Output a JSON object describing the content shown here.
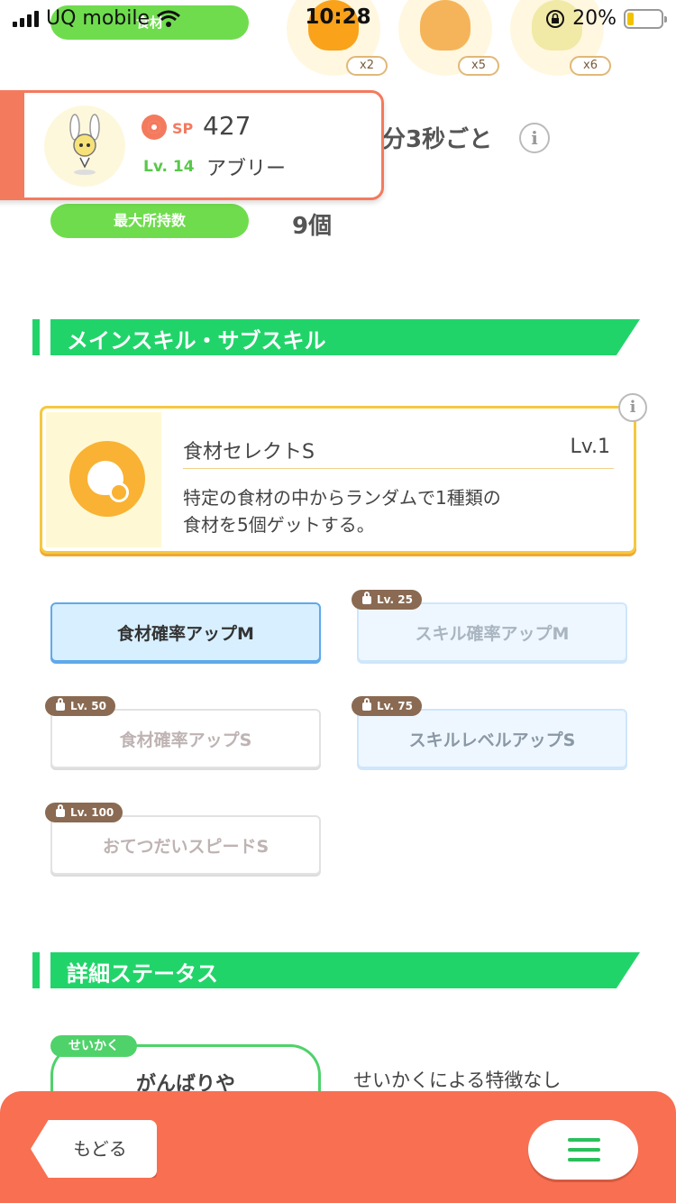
{
  "status_bar": {
    "carrier": "UQ mobile",
    "time": "10:28",
    "battery": "20%",
    "battery_level": 0.2
  },
  "ingredients": [
    {
      "icon": "honey-jar-icon",
      "count": "x2",
      "color": "#f9a21a"
    },
    {
      "icon": "honey-pot-icon",
      "count": "x5",
      "color": "#f6b45a"
    },
    {
      "icon": "oil-bottle-icon",
      "count": "x6",
      "color": "#f1e9a6"
    }
  ],
  "top_pill": {
    "label": "食材"
  },
  "pokemon": {
    "sp_label": "SP",
    "sp_value": "427",
    "level": "Lv. 14",
    "name": "アブリー"
  },
  "help_frequency": "分3秒ごと",
  "max_capacity": {
    "label": "最大所持数",
    "value": "9個"
  },
  "skills_section": {
    "title": "メインスキル・サブスキル"
  },
  "main_skill": {
    "name": "食材セレクトS",
    "level": "Lv.1",
    "description_line1": "特定の食材の中からランダムで1種類の",
    "description_line2": "食材を5個ゲットする。"
  },
  "sub_skills": [
    {
      "label": "食材確率アップM",
      "lock": ""
    },
    {
      "label": "スキル確率アップM",
      "lock": "Lv. 25"
    },
    {
      "label": "食材確率アップS",
      "lock": "Lv. 50"
    },
    {
      "label": "スキルレベルアップS",
      "lock": "Lv. 75"
    },
    {
      "label": "おてつだいスピードS",
      "lock": "Lv. 100"
    }
  ],
  "details_section": {
    "title": "詳細ステータス"
  },
  "nature": {
    "tag": "せいかく",
    "name": "がんばりや",
    "effect": "せいかくによる特徴なし"
  },
  "bottom_bar": {
    "back_label": "もどる"
  },
  "colors": {
    "accent_green": "#21d46a",
    "accent_orange": "#f86f52",
    "skill_gold": "#f9b233",
    "subskill_blue": "#5fa9ea"
  }
}
